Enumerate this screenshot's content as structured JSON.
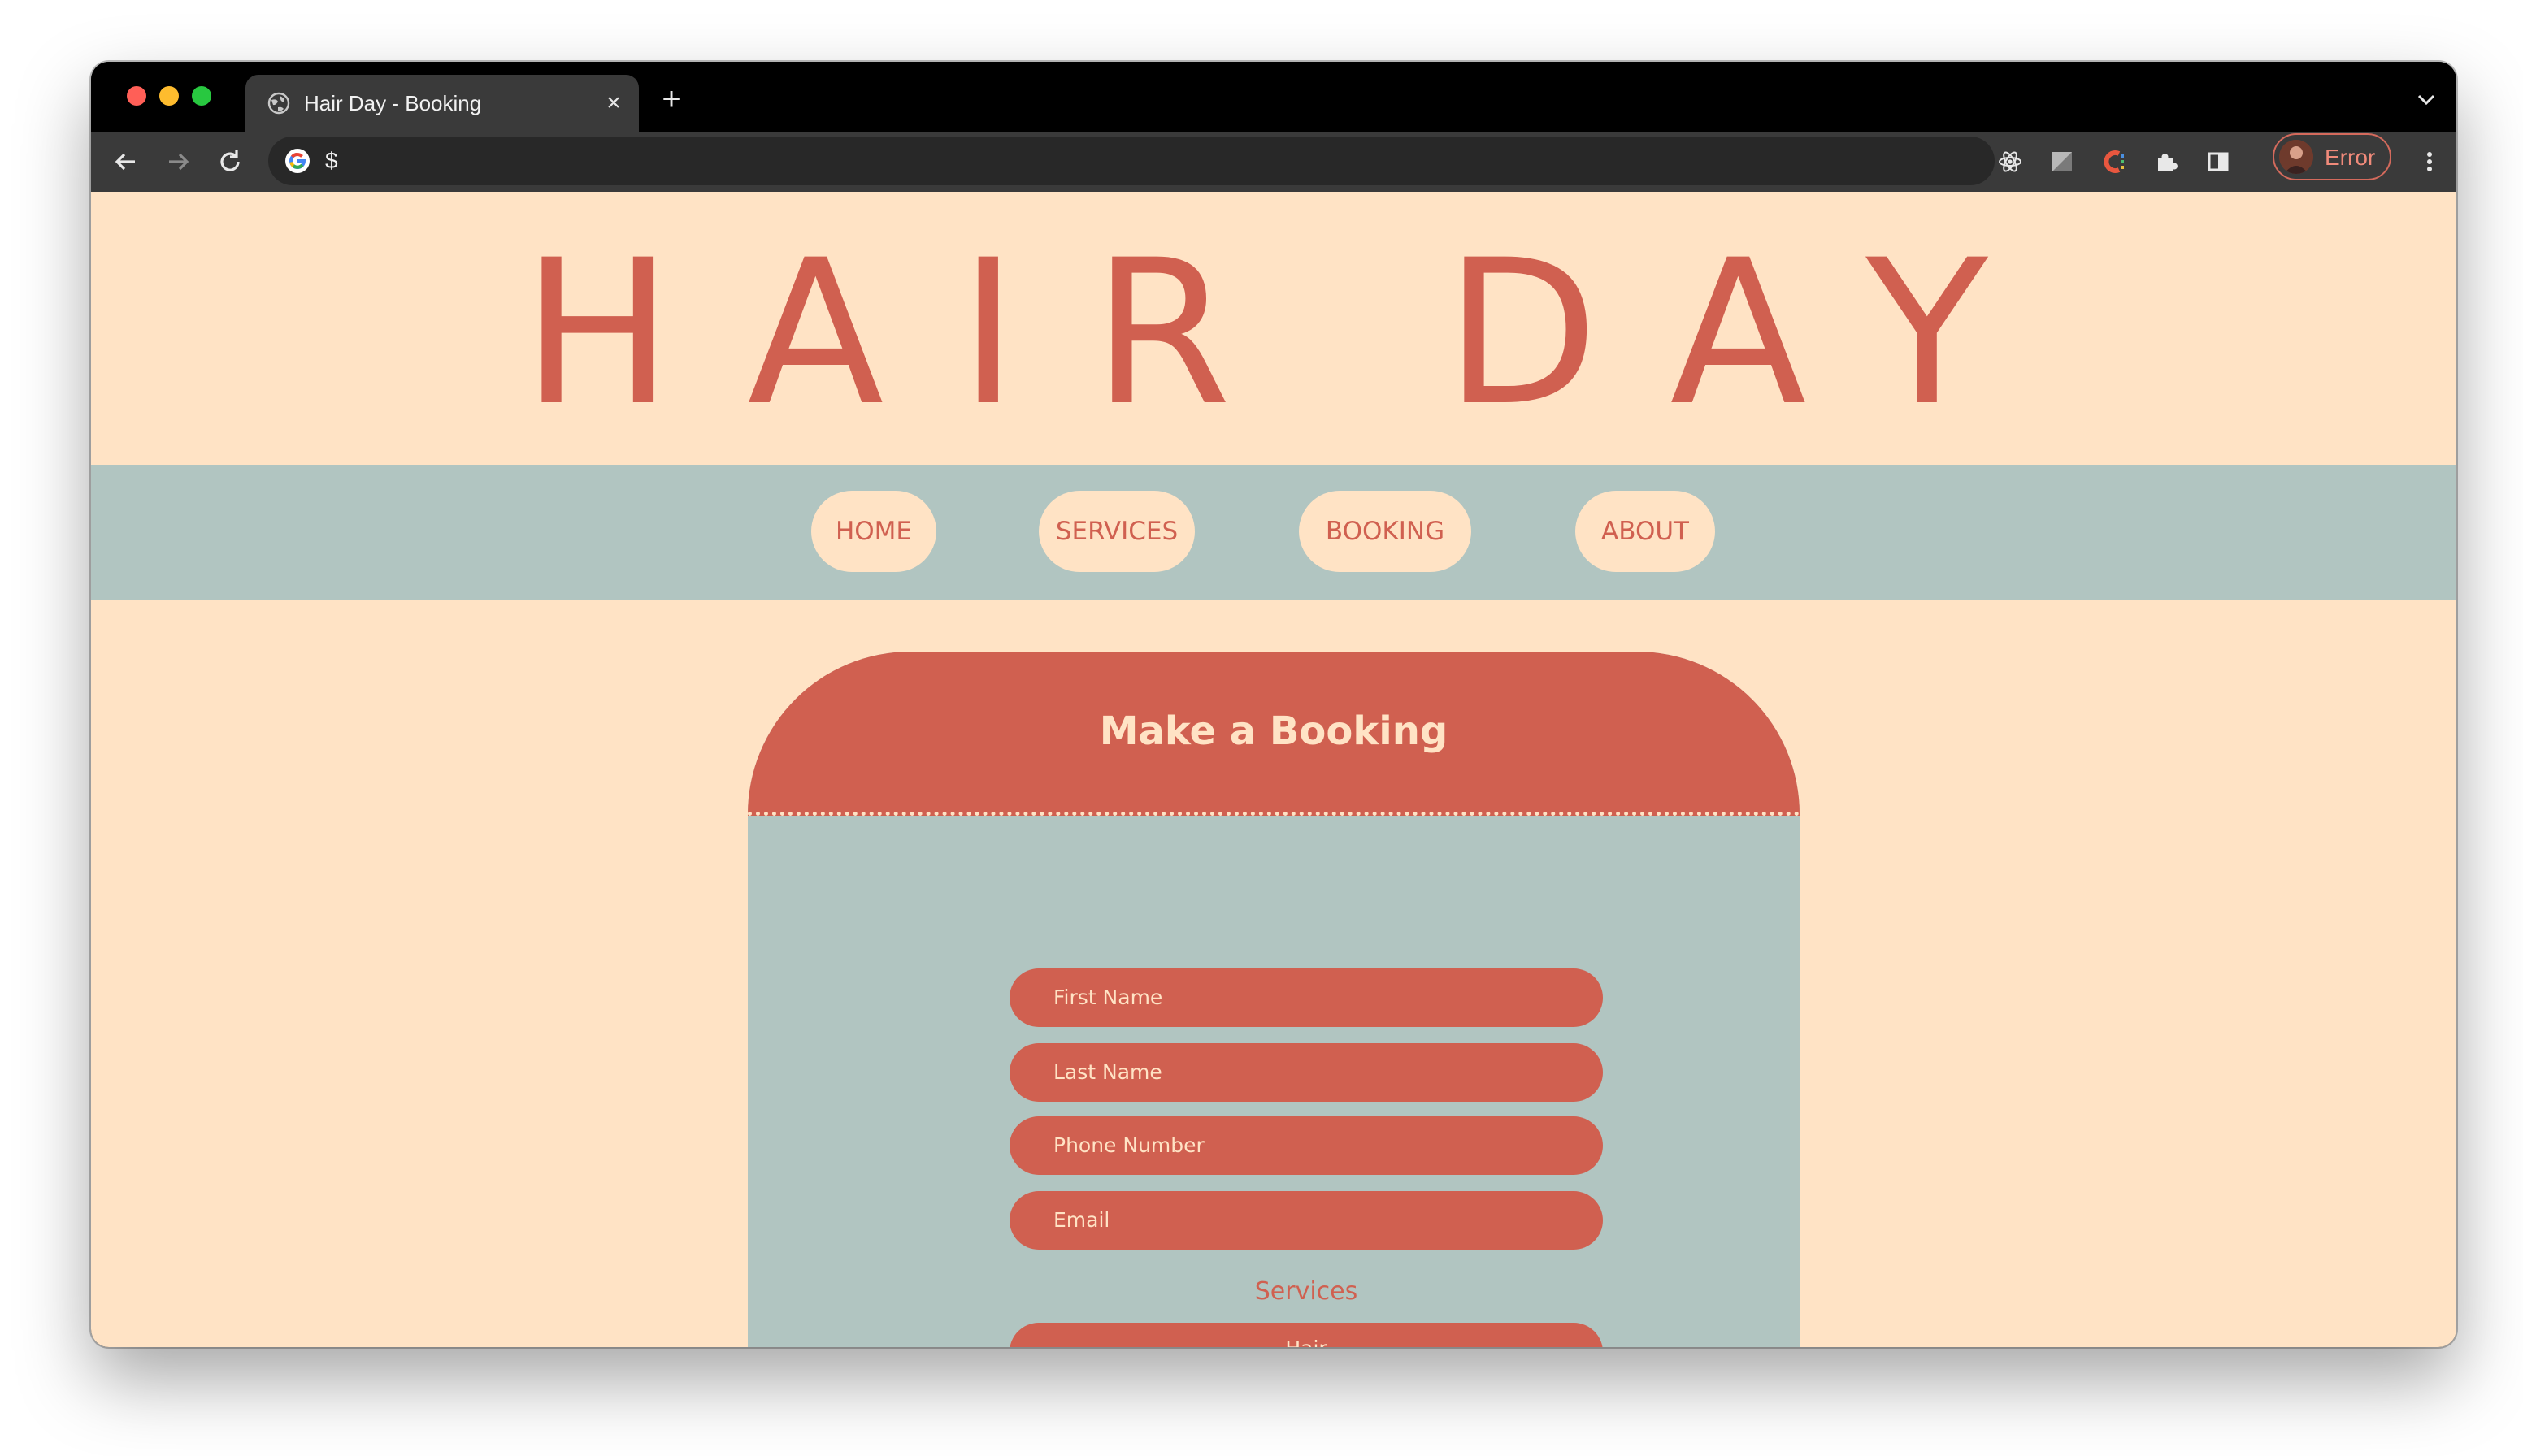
{
  "browser": {
    "tab_title": "Hair Day - Booking",
    "tab_close_symbol": "×",
    "new_tab_symbol": "+",
    "url": "$",
    "profile_label": "Error"
  },
  "site": {
    "title": "HAIR DAY",
    "nav": [
      {
        "label": "HOME"
      },
      {
        "label": "SERVICES"
      },
      {
        "label": "BOOKING"
      },
      {
        "label": "ABOUT"
      }
    ]
  },
  "booking": {
    "heading": "Make a Booking",
    "fields": [
      {
        "placeholder": "First Name"
      },
      {
        "placeholder": "Last Name"
      },
      {
        "placeholder": "Phone Number"
      },
      {
        "placeholder": "Email"
      }
    ],
    "services_label": "Services",
    "services_selected": "Hair"
  },
  "colors": {
    "page_bg": "#ffe3c5",
    "accent": "#d06050",
    "nav_bg": "#b1c5c1"
  }
}
